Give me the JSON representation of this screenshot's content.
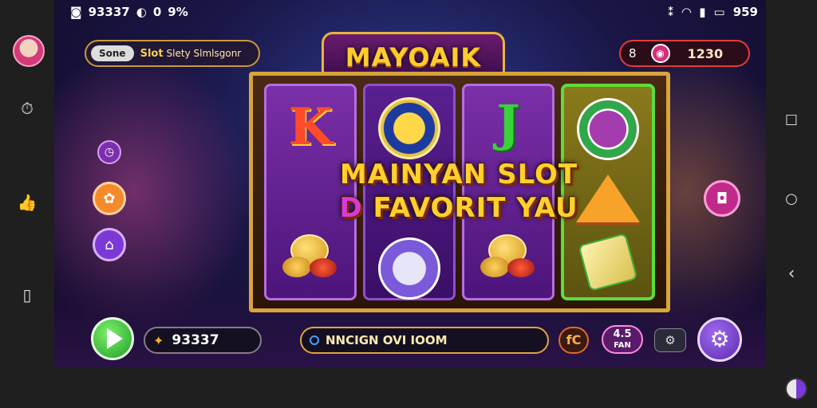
{
  "status_bar": {
    "left_text": "93337",
    "battery_small": "0",
    "percent_text": "9%",
    "right_text": "959"
  },
  "left_rail": {
    "icons": [
      "avatar",
      "timer-icon",
      "thumbs-icon",
      "book-icon"
    ]
  },
  "right_rail": {
    "icons": [
      "square-nav-icon",
      "circle-nav-icon",
      "back-nav-icon"
    ]
  },
  "top_left_pill": {
    "tag": "Sone",
    "label": "Slot",
    "sublabel": "Slety Slmlsgonr"
  },
  "top_right_pill": {
    "lock_glyph": "8",
    "chip_glyph": "◉",
    "value": "1230"
  },
  "logo": {
    "text": "MAYOAIK"
  },
  "banner": {
    "line1": "MAINYAN SLOT",
    "line2_accent": "D",
    "line2": "FAVORIT YAU"
  },
  "reels": {
    "reel1_top": "K",
    "reel3_top": "J"
  },
  "bottom": {
    "balance": "93337",
    "ticker": "NNCIGN OVI IOOM",
    "bet_label": "fC",
    "speed_label": "4.5",
    "speed_sub": "FAN",
    "auto_label": "⚙"
  },
  "colors": {
    "accent_gold": "#ffcc2e",
    "accent_purple": "#7b2fa8",
    "accent_green": "#3bd13b"
  }
}
